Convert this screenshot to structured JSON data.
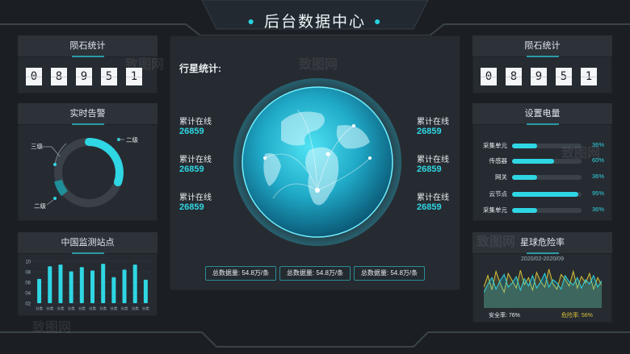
{
  "header": {
    "title": "后台数据中心"
  },
  "meteor_left": {
    "title": "陨石统计",
    "digits": [
      "0",
      "8",
      "9",
      "5",
      "1"
    ]
  },
  "meteor_right": {
    "title": "陨石统计",
    "digits": [
      "0",
      "8",
      "9",
      "5",
      "1"
    ]
  },
  "alarm": {
    "title": "实时告警",
    "labels": {
      "level3": "三级",
      "level2": "二级",
      "level2b": "二级"
    }
  },
  "stations": {
    "title": "中国监测站点",
    "ylabels": [
      "10",
      "08",
      "06",
      "04",
      "02"
    ],
    "xlabel": "分类"
  },
  "center": {
    "title": "行星统计:",
    "stats_left": [
      {
        "label": "累计在线",
        "value": "26859"
      },
      {
        "label": "累计在线",
        "value": "26859"
      },
      {
        "label": "累计在线",
        "value": "26859"
      }
    ],
    "stats_right": [
      {
        "label": "累计在线",
        "value": "26859"
      },
      {
        "label": "累计在线",
        "value": "26859"
      },
      {
        "label": "累计在线",
        "value": "26859"
      }
    ],
    "pills": [
      "总数据量: 54.8万/条",
      "总数据量: 54.8万/条",
      "总数据量: 54.8万/条"
    ]
  },
  "power": {
    "title": "设置电量",
    "rows": [
      {
        "label": "采集单元",
        "pct": "36%",
        "value": 0.36
      },
      {
        "label": "传感器",
        "pct": "60%",
        "value": 0.6
      },
      {
        "label": "网关",
        "pct": "36%",
        "value": 0.36
      },
      {
        "label": "云节点",
        "pct": "95%",
        "value": 0.95
      },
      {
        "label": "采集单元",
        "pct": "36%",
        "value": 0.36
      }
    ]
  },
  "danger": {
    "title": "星球危险率",
    "date_range": "2020/02-2020/09",
    "safe": "安全率: 76%",
    "risk": "危险率: 56%"
  },
  "watermark": "致图网",
  "colors": {
    "accent": "#2fd6e3",
    "bg": "#1b1f24",
    "panel": "#262b31",
    "yellow": "#d8c23a"
  },
  "chart_data": [
    {
      "type": "bar",
      "categories": [
        "分类",
        "分类",
        "分类",
        "分类",
        "分类",
        "分类",
        "分类",
        "分类",
        "分类",
        "分类",
        "分类"
      ],
      "values": [
        5.8,
        8.8,
        9.2,
        7.6,
        8.6,
        7.8,
        9.4,
        6.2,
        8.0,
        9.2,
        5.6
      ],
      "ylim": [
        0,
        10
      ],
      "grid": true
    },
    {
      "type": "line",
      "x": [
        0,
        1,
        2,
        3,
        4,
        5,
        6,
        7,
        8,
        9,
        10,
        11,
        12,
        13,
        14,
        15,
        16,
        17,
        18,
        19,
        20,
        21,
        22,
        23,
        24,
        25,
        26,
        27,
        28,
        29
      ],
      "series": [
        {
          "values": [
            40,
            62,
            35,
            70,
            48,
            30,
            66,
            52,
            38,
            72,
            45,
            58,
            34,
            68,
            50,
            40,
            74,
            46,
            36,
            64,
            55,
            42,
            70,
            38,
            60,
            48,
            66,
            36,
            58,
            44
          ]
        },
        {
          "values": [
            30,
            45,
            58,
            36,
            52,
            64,
            40,
            48,
            60,
            34,
            56,
            42,
            62,
            38,
            50,
            66,
            40,
            54,
            48,
            36,
            62,
            50,
            44,
            58,
            38,
            54,
            46,
            62,
            40,
            52
          ]
        }
      ]
    }
  ]
}
